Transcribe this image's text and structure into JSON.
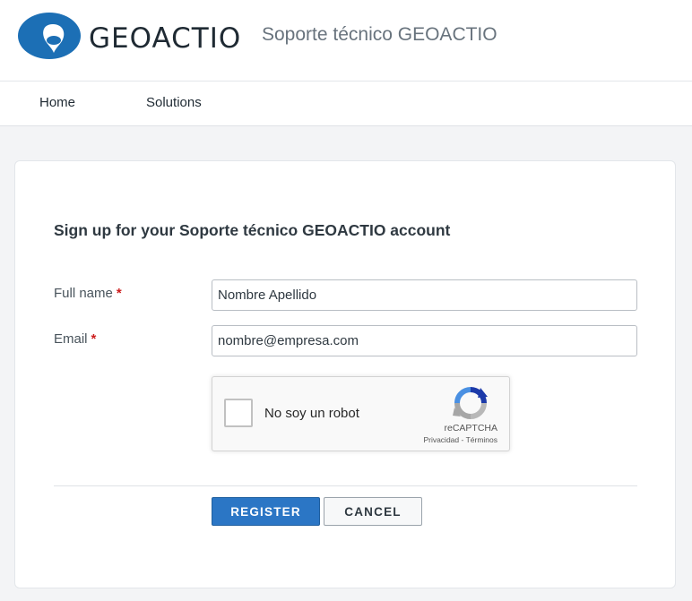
{
  "header": {
    "logo_text": "GEOACTIO",
    "brand_title": "Soporte técnico GEOACTIO"
  },
  "nav": {
    "items": [
      {
        "label": "Home"
      },
      {
        "label": "Solutions"
      }
    ]
  },
  "form": {
    "title": "Sign up for your Soporte técnico GEOACTIO account",
    "required_marker": "*",
    "fields": [
      {
        "label": "Full name",
        "value": "Nombre Apellido"
      },
      {
        "label": "Email",
        "value": "nombre@empresa.com"
      }
    ],
    "captcha": {
      "label": "No soy un robot",
      "brand": "reCAPTCHA",
      "privacy": "Privacidad",
      "separator": "-",
      "terms": "Términos"
    },
    "buttons": {
      "register": "REGISTER",
      "cancel": "CANCEL"
    }
  },
  "colors": {
    "logo_blue": "#1c6fb5",
    "primary_button": "#2b76c5",
    "required": "#cc1d1d",
    "page_background": "#f3f4f6"
  }
}
